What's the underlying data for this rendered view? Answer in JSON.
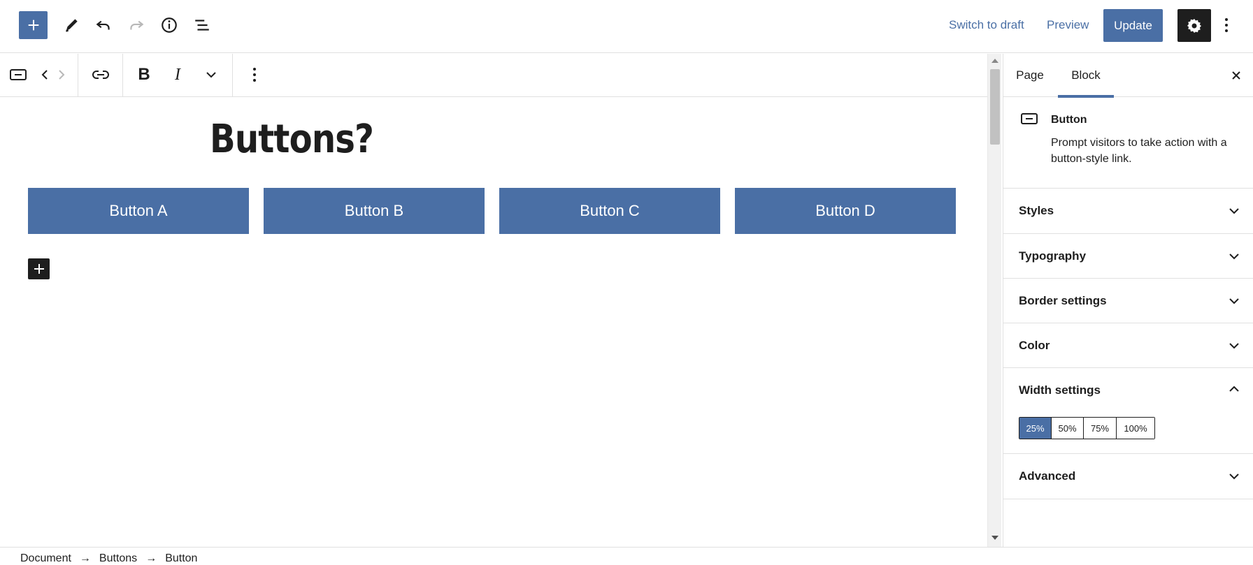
{
  "header": {
    "switch_to_draft_label": "Switch to draft",
    "preview_label": "Preview",
    "update_label": "Update",
    "icons": [
      "plus-icon",
      "pencil-icon",
      "undo-icon",
      "redo-icon",
      "info-icon",
      "list-view-icon",
      "gear-icon",
      "more-vertical-icon"
    ]
  },
  "block_toolbar": {
    "icons": [
      "button-block-icon",
      "chevron-left-icon",
      "chevron-right-icon",
      "link-icon",
      "bold-icon",
      "italic-icon",
      "chevron-down-icon",
      "more-vertical-icon"
    ],
    "bold_label": "B",
    "italic_label": "I"
  },
  "canvas": {
    "title": "Buttons?",
    "buttons": [
      "Button A",
      "Button B",
      "Button C",
      "Button D"
    ]
  },
  "sidebar": {
    "tabs": [
      "Page",
      "Block"
    ],
    "active_tab": "Block",
    "block_card": {
      "title": "Button",
      "description": "Prompt visitors to take action with a button-style link."
    },
    "panels": [
      {
        "title": "Styles",
        "open": false
      },
      {
        "title": "Typography",
        "open": false
      },
      {
        "title": "Border settings",
        "open": false
      },
      {
        "title": "Color",
        "open": false
      },
      {
        "title": "Width settings",
        "open": true
      },
      {
        "title": "Advanced",
        "open": false
      }
    ],
    "width_options": [
      "25%",
      "50%",
      "75%",
      "100%"
    ],
    "width_selected": "25%"
  },
  "footer": {
    "breadcrumbs": [
      "Document",
      "Buttons",
      "Button"
    ],
    "separator": "→"
  },
  "colors": {
    "accent": "#4a6fa5",
    "dark": "#1e1e1e",
    "border": "#e0e0e0"
  }
}
